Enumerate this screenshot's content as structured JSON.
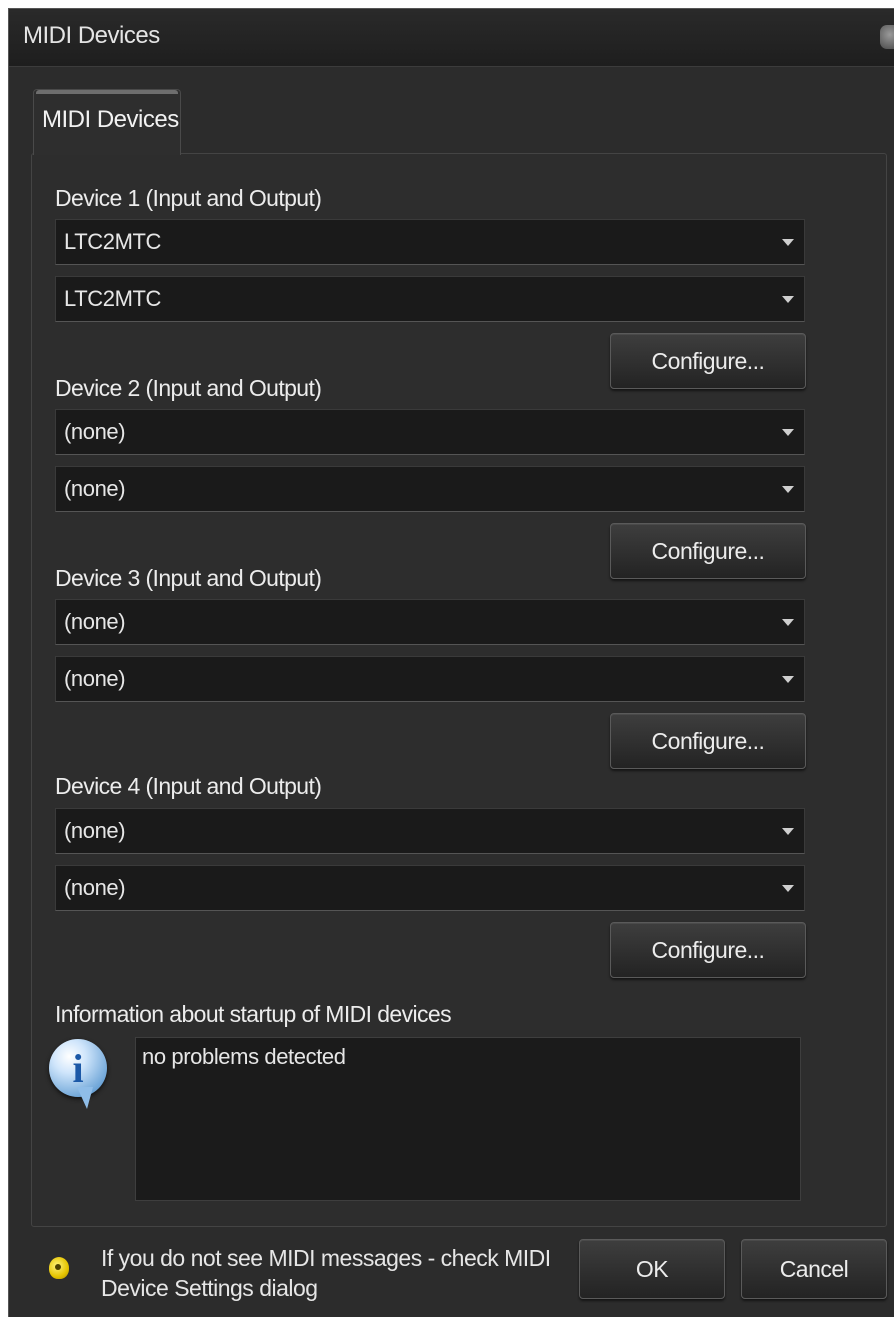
{
  "window": {
    "title": "MIDI Devices"
  },
  "tab": {
    "label": "MIDI Devices"
  },
  "devices": [
    {
      "label": "Device 1 (Input and Output)",
      "input": "LTC2MTC",
      "output": "LTC2MTC",
      "configure": "Configure..."
    },
    {
      "label": "Device 2 (Input and Output)",
      "input": "(none)",
      "output": "(none)",
      "configure": "Configure..."
    },
    {
      "label": "Device 3 (Input and Output)",
      "input": "(none)",
      "output": "(none)",
      "configure": "Configure..."
    },
    {
      "label": "Device 4 (Input and Output)",
      "input": "(none)",
      "output": "(none)",
      "configure": "Configure..."
    }
  ],
  "info": {
    "label": "Information about startup of MIDI devices",
    "text": "no problems detected",
    "icon": "info-icon"
  },
  "footer": {
    "hint": "If you do not see MIDI messages - check MIDI Device Settings dialog",
    "hint_icon": "midi-connector-icon",
    "ok": "OK",
    "cancel": "Cancel"
  }
}
